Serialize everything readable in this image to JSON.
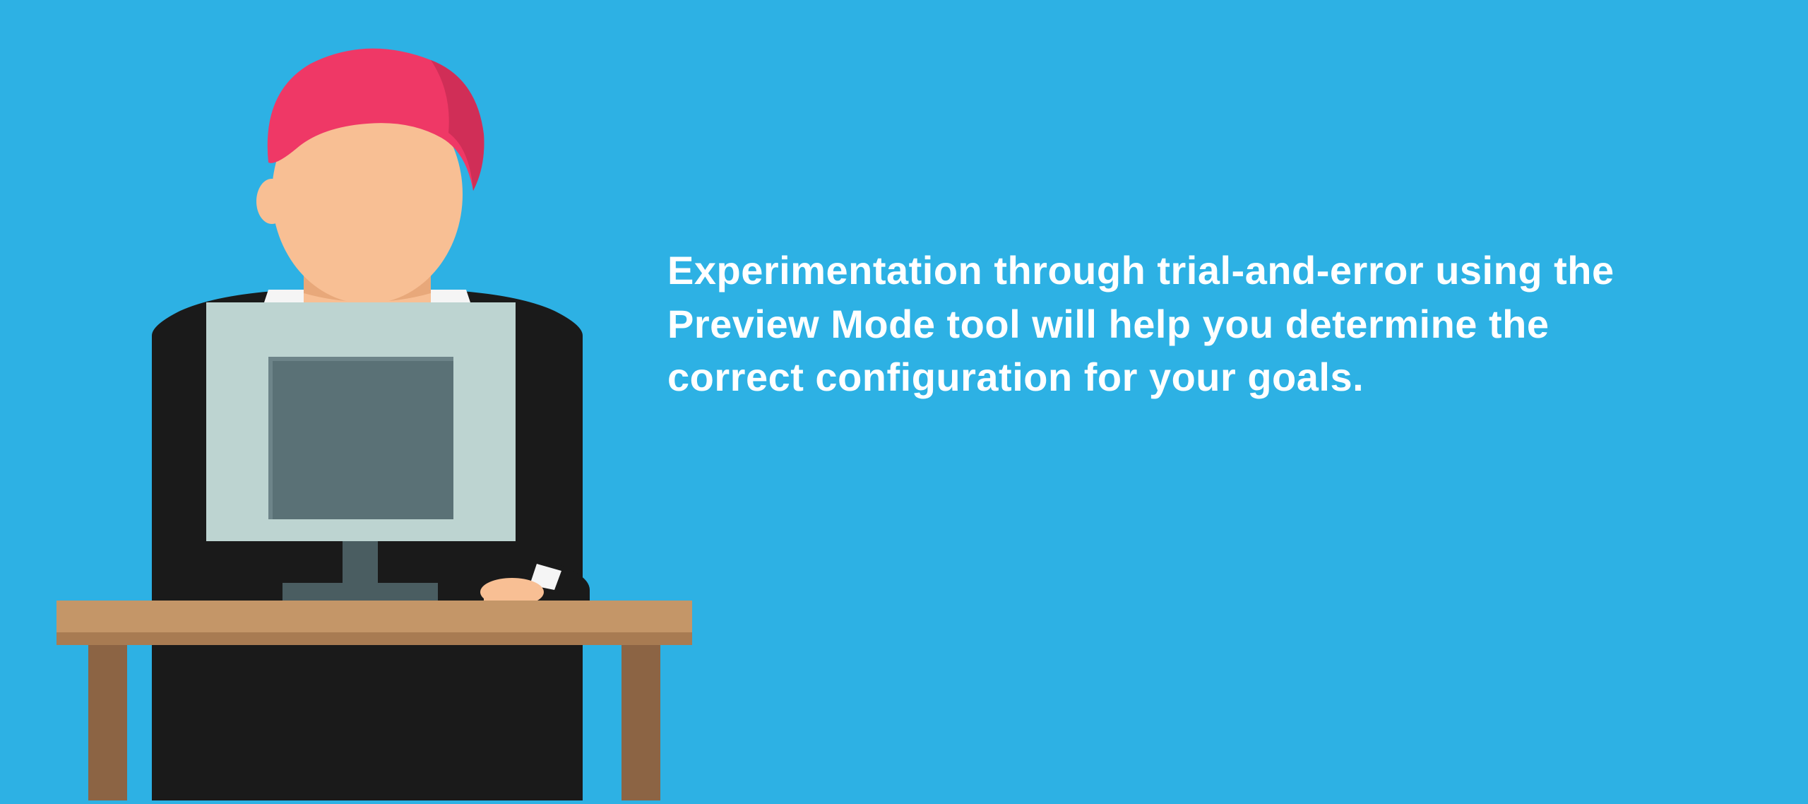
{
  "message": "Experimentation through trial-and-error using the Preview Mode tool will help you determine the correct configuration for your goals.",
  "colors": {
    "background": "#2db1e4",
    "text": "#ffffff",
    "hair": "#ef3866",
    "hair_shadow": "#d02e57",
    "skin": "#f8bf94",
    "skin_shadow": "#e8a87a",
    "suit": "#1a1a1a",
    "shirt": "#f5f5f5",
    "monitor_frame": "#bdd4d1",
    "monitor_screen": "#5a7176",
    "monitor_stand": "#4a5d61",
    "desk_top": "#c49668",
    "desk_side": "#a87b52",
    "desk_legs": "#8c6444"
  }
}
